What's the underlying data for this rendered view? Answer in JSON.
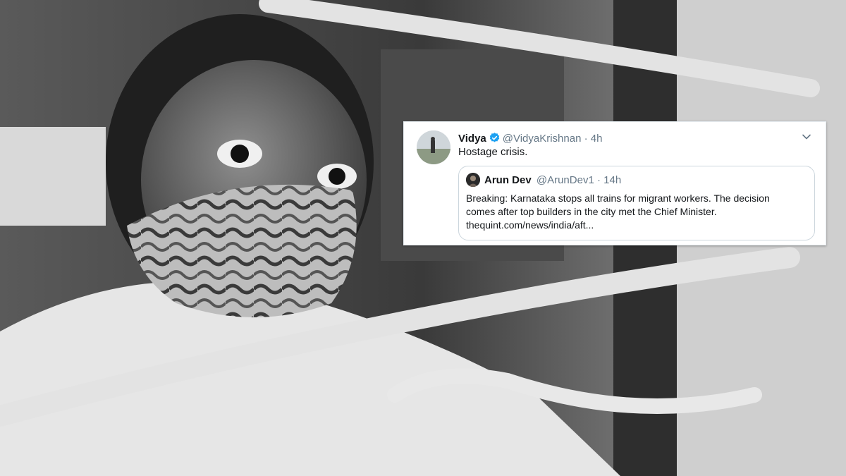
{
  "tweet": {
    "name": "Vidya",
    "handle": "@VidyaKrishnan",
    "separator": "·",
    "time": "4h",
    "text": "Hostage crisis.",
    "avatar_icon": "user-avatar",
    "verified_icon": "verified-badge-icon",
    "menu_icon": "chevron-down-icon",
    "quoted": {
      "name": "Arun Dev",
      "handle": "@ArunDev1",
      "separator": "·",
      "time": "14h",
      "text_lines": [
        "Breaking: Karnataka stops all trains for migrant workers. The decision",
        "comes after top builders in the city met the Chief Minister.",
        "thequint.com/news/india/aft..."
      ]
    }
  },
  "colors": {
    "verified": "#1da1f2",
    "secondary_text": "#657786",
    "primary_text": "#14171a",
    "border": "#ccd6dd"
  }
}
